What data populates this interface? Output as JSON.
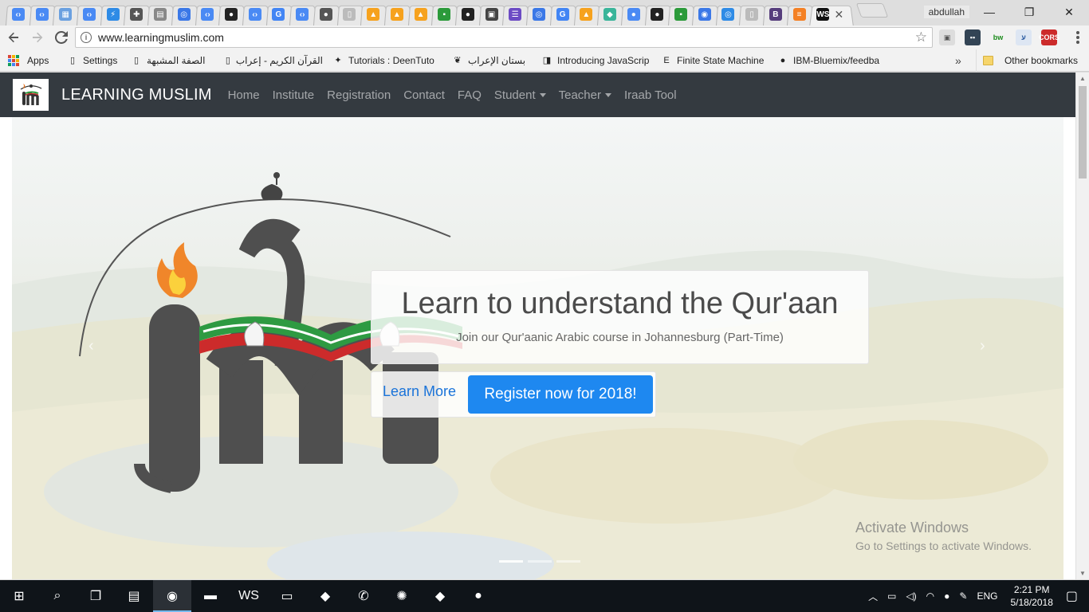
{
  "browser": {
    "tab_favicons": [
      {
        "name": "chrome-ext-icon",
        "color": "#4a8af4",
        "glyph": "‹›"
      },
      {
        "name": "chrome-ext-icon",
        "color": "#4a8af4",
        "glyph": "‹›"
      },
      {
        "name": "grid-app-icon",
        "color": "#6aa0e0",
        "glyph": "▦"
      },
      {
        "name": "chrome-ext-icon",
        "color": "#4a8af4",
        "glyph": "‹›"
      },
      {
        "name": "lightning-icon",
        "color": "#2e8be6",
        "glyph": "⚡"
      },
      {
        "name": "puzzle-icon",
        "color": "#555555",
        "glyph": "✚"
      },
      {
        "name": "doc-icon",
        "color": "#888888",
        "glyph": "▤"
      },
      {
        "name": "chrome-icon",
        "color": "#3b78e7",
        "glyph": "◎"
      },
      {
        "name": "chrome-ext-icon",
        "color": "#4a8af4",
        "glyph": "‹›"
      },
      {
        "name": "github-icon",
        "color": "#222222",
        "glyph": "●"
      },
      {
        "name": "chrome-ext-icon",
        "color": "#4a8af4",
        "glyph": "‹›"
      },
      {
        "name": "google-icon",
        "color": "#4285f4",
        "glyph": "G"
      },
      {
        "name": "chrome-ext-icon",
        "color": "#4a8af4",
        "glyph": "‹›"
      },
      {
        "name": "github-icon",
        "color": "#555555",
        "glyph": "●"
      },
      {
        "name": "page-icon",
        "color": "#bbbbbb",
        "glyph": "▯"
      },
      {
        "name": "firebase-icon",
        "color": "#f6a21e",
        "glyph": "▲"
      },
      {
        "name": "firebase-icon",
        "color": "#f6a21e",
        "glyph": "▲"
      },
      {
        "name": "firebase-icon",
        "color": "#f6a21e",
        "glyph": "▲"
      },
      {
        "name": "flag-icon",
        "color": "#2b9a3a",
        "glyph": "▪"
      },
      {
        "name": "github-icon",
        "color": "#222222",
        "glyph": "●"
      },
      {
        "name": "contact-card-icon",
        "color": "#444444",
        "glyph": "▣"
      },
      {
        "name": "list-app-icon",
        "color": "#6c4bc4",
        "glyph": "☰"
      },
      {
        "name": "chrome-icon",
        "color": "#3b78e7",
        "glyph": "◎"
      },
      {
        "name": "google-icon",
        "color": "#4285f4",
        "glyph": "G"
      },
      {
        "name": "firebase-icon",
        "color": "#f6a21e",
        "glyph": "▲"
      },
      {
        "name": "diamond-icon",
        "color": "#3ab59a",
        "glyph": "◆"
      },
      {
        "name": "chrome-ext-icon",
        "color": "#4a8af4",
        "glyph": "●"
      },
      {
        "name": "github-icon",
        "color": "#222222",
        "glyph": "●"
      },
      {
        "name": "flag-icon",
        "color": "#2b9a3a",
        "glyph": "▪"
      },
      {
        "name": "chat-icon",
        "color": "#3b78e7",
        "glyph": "◉"
      },
      {
        "name": "target-icon",
        "color": "#2e8be6",
        "glyph": "◎"
      },
      {
        "name": "page-icon",
        "color": "#bbbbbb",
        "glyph": "▯"
      },
      {
        "name": "bootstrap-icon",
        "color": "#563d7c",
        "glyph": "B"
      },
      {
        "name": "stackoverflow-icon",
        "color": "#f48024",
        "glyph": "≡"
      },
      {
        "name": "webstorm-icon",
        "color": "#111111",
        "glyph": "WS"
      }
    ],
    "profile_name": "abdullah",
    "window_controls": {
      "minimize": "—",
      "maximize": "❐",
      "close": "✕"
    },
    "url": "www.learningmuslim.com",
    "extensions": [
      {
        "name": "extension-icon-1",
        "glyph": "▣",
        "color": "#555555",
        "bg": "#dddddd"
      },
      {
        "name": "extension-icon-2",
        "glyph": "▪▪",
        "color": "#ffffff",
        "bg": "#334455"
      },
      {
        "name": "bw-extension-icon",
        "glyph": "bw",
        "color": "#1a8a1a",
        "bg": "transparent"
      },
      {
        "name": "extension-icon-4",
        "glyph": "ע",
        "color": "#2a5aa0",
        "bg": "#dde6f3"
      },
      {
        "name": "cors-extension-icon",
        "glyph": "CORS",
        "color": "#ffffff",
        "bg": "#cc2b2b"
      }
    ],
    "bookmarks": [
      {
        "label": "Apps",
        "icon": "apps-grid-icon"
      },
      {
        "label": "Settings",
        "icon": "page-icon"
      },
      {
        "label": "الصفة المشبهة",
        "icon": "page-icon"
      },
      {
        "label": "القرآن الكريم - إعراب",
        "icon": "page-icon"
      },
      {
        "label": "Tutorials : DeenTuto",
        "icon": "deentutor-icon"
      },
      {
        "label": "بستان الإعراب",
        "icon": "garden-icon"
      },
      {
        "label": "Introducing JavaScrip",
        "icon": "js-bookmark-icon"
      },
      {
        "label": "Finite State Machine",
        "icon": "e-bookmark-icon"
      },
      {
        "label": "IBM-Bluemix/feedba",
        "icon": "github-icon"
      }
    ],
    "other_bookmarks": "Other bookmarks",
    "bookmarks_overflow": "»"
  },
  "site": {
    "brand": "LEARNING MUSLIM",
    "nav": [
      {
        "label": "Home",
        "dropdown": false
      },
      {
        "label": "Institute",
        "dropdown": false
      },
      {
        "label": "Registration",
        "dropdown": false
      },
      {
        "label": "Contact",
        "dropdown": false
      },
      {
        "label": "FAQ",
        "dropdown": false
      },
      {
        "label": "Student",
        "dropdown": true
      },
      {
        "label": "Teacher",
        "dropdown": true
      },
      {
        "label": "Iraab Tool",
        "dropdown": false
      }
    ],
    "hero": {
      "title": "Learn to understand the Qur'aan",
      "subtitle": "Join our Qur'aanic Arabic course in Johannesburg (Part-Time)",
      "learn_more": "Learn More",
      "register": "Register now for 2018!",
      "prev_arrow": "‹",
      "next_arrow": "›"
    },
    "watermark": {
      "line1": "Activate Windows",
      "line2": "Go to Settings to activate Windows."
    }
  },
  "taskbar": {
    "apps": [
      {
        "name": "start-button",
        "glyph": "⊞"
      },
      {
        "name": "search-icon",
        "glyph": "⌕"
      },
      {
        "name": "task-view-icon",
        "glyph": "❐"
      },
      {
        "name": "control-panel-icon",
        "glyph": "▤"
      },
      {
        "name": "chrome-icon",
        "glyph": "◉"
      },
      {
        "name": "file-explorer-icon",
        "glyph": "▬"
      },
      {
        "name": "webstorm-icon",
        "glyph": "WS"
      },
      {
        "name": "remote-desktop-icon",
        "glyph": "▭"
      },
      {
        "name": "git-icon",
        "glyph": "◆"
      },
      {
        "name": "whatsapp-icon",
        "glyph": "✆"
      },
      {
        "name": "frog-icon",
        "glyph": "✺"
      },
      {
        "name": "git-icon-2",
        "glyph": "◆"
      },
      {
        "name": "github-desktop-icon",
        "glyph": "●"
      }
    ],
    "language": "ENG",
    "time": "2:21 PM",
    "date": "5/18/2018"
  }
}
